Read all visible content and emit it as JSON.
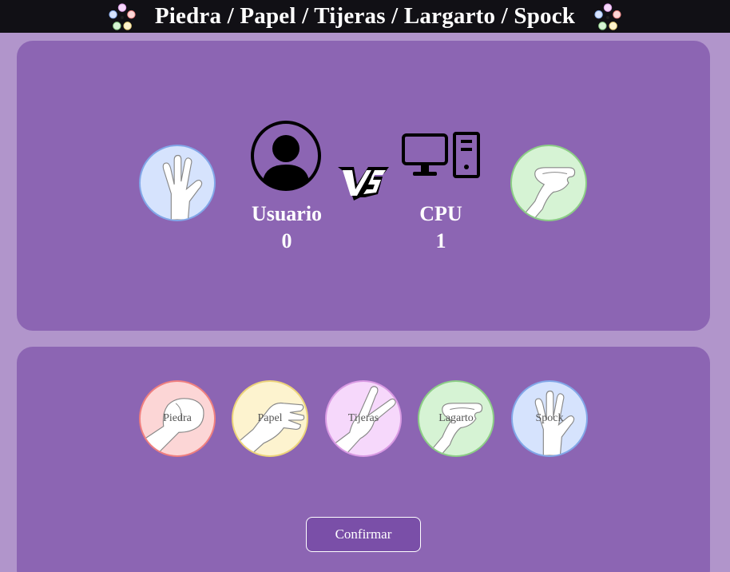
{
  "header": {
    "title": "Piedra / Papel / Tijeras / Largarto / Spock",
    "left_logo": "rpsls-logo-icon",
    "right_logo": "rpsls-logo-icon"
  },
  "arena": {
    "user": {
      "name": "Usuario",
      "score": "0",
      "choice": "spock",
      "avatar": "user-silhouette-icon"
    },
    "cpu": {
      "name": "CPU",
      "score": "1",
      "choice": "lizard",
      "avatar": "computer-icon"
    },
    "vs_icon": "vs-icon"
  },
  "choices": [
    {
      "id": "rock",
      "label": "Piedra",
      "color": "#fcd6d6",
      "border": "#ef7f7f"
    },
    {
      "id": "paper",
      "label": "Papel",
      "color": "#fdf3cf",
      "border": "#ecd37a"
    },
    {
      "id": "scissors",
      "label": "Tijeras",
      "color": "#f6d8fb",
      "border": "#d99ae3"
    },
    {
      "id": "lizard",
      "label": "Lagarto",
      "color": "#d6f3d4",
      "border": "#8ccd86"
    },
    {
      "id": "spock",
      "label": "Spock",
      "color": "#d6e3fd",
      "border": "#82a7e8"
    }
  ],
  "confirm_label": "Confirmar",
  "colors": {
    "background": "#b195cb",
    "panel": "#8c65b3",
    "header": "#111015",
    "button": "#7a4fa8"
  }
}
